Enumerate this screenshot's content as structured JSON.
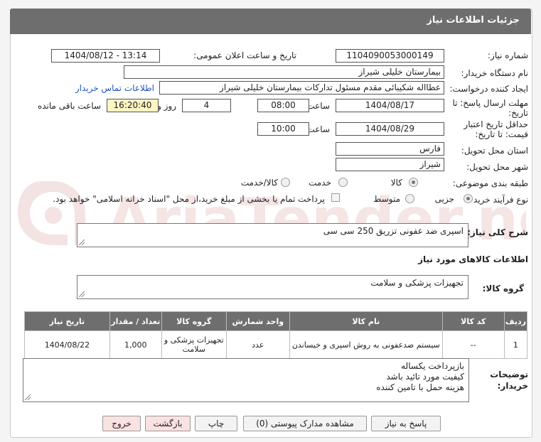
{
  "header": {
    "title": "جزئیات اطلاعات نیاز"
  },
  "fields": {
    "need_number_label": "شماره نیاز:",
    "need_number": "1104090053000149",
    "announce_label": "تاریخ و ساعت اعلان عمومی:",
    "announce_value": "1404/08/12 - 13:14",
    "buyer_label": "نام دستگاه خریدار:",
    "buyer_value": "بیمارستان خلیلی شیراز",
    "creator_label": "ایجاد کننده درخواست:",
    "creator_value": "عطااله شکیبائی مقدم مسئول تدارکات  بیمارستان خلیلی شیراز",
    "contact_link": "اطلاعات تماس خریدار",
    "deadline_label_1": "مهلت ارسال پاسخ: تا",
    "deadline_label_2": "تاریخ:",
    "deadline_date": "1404/08/17",
    "time_label": "ساعت",
    "deadline_time": "08:00",
    "days_value": "4",
    "days_label": "روز و",
    "remaining_time": "16:20:40",
    "remaining_label": "ساعت باقی مانده",
    "validity_label_1": "حداقل تاریخ اعتبار",
    "validity_label_2": "قیمت: تا تاریخ:",
    "validity_date": "1404/08/29",
    "validity_time_label": "ساعت",
    "validity_time": "10:00",
    "province_label": "استان محل تحویل:",
    "province_value": "فارس",
    "city_label": "شهر محل تحویل:",
    "city_value": "شیراز",
    "category_label": "طبقه بندی موضوعی:",
    "category_options": [
      "کالا",
      "خدمت",
      "کالا/خدمت"
    ],
    "process_label": "نوع فرآیند خرید :",
    "process_options": [
      "جزیی",
      "متوسط"
    ],
    "payment_note": "پرداخت تمام یا بخشی از مبلغ خرید،از محل \"اسناد خزانه اسلامی\" خواهد بود.",
    "desc_label": "شرح کلی نیاز:",
    "desc_value": "اسپری ضد عفونی تزریق 250 سی سی",
    "goods_info_title": "اطلاعات کالاهای مورد نیاز",
    "group_label": "گروه کالا:",
    "group_value": "تجهیزات پزشکی و سلامت",
    "notes_label_1": "توضیحات",
    "notes_label_2": "خریدار:",
    "notes_lines": [
      "بازپرداخت یکساله",
      "کیفیت مورد تائید باشد",
      "هزینه حمل با تامین کننده"
    ]
  },
  "table": {
    "headers": [
      "ردیف",
      "کد کالا",
      "نام کالا",
      "واحد شمارش",
      "گروه کالا",
      "تعداد / مقدار",
      "تاریخ نیاز"
    ],
    "rows": [
      [
        "1",
        "--",
        "سیستم ضدعفونی به روش اسپری و خیساندن",
        "عدد",
        "تجهیزات پزشکی و سلامت",
        "1,000",
        "1404/08/22"
      ]
    ]
  },
  "buttons": {
    "reply": "پاسخ به نیاز",
    "docs": "مشاهده مدارک پیوستی (0)",
    "print": "چاپ",
    "back": "بازگشت",
    "exit": "خروج"
  },
  "watermark": "AriaTender.neT",
  "colors": {
    "header_bg": "#6e6e6e",
    "highlight": "#fff5c2",
    "link": "#2255bb",
    "exit_bg": "#fbe2e2"
  }
}
